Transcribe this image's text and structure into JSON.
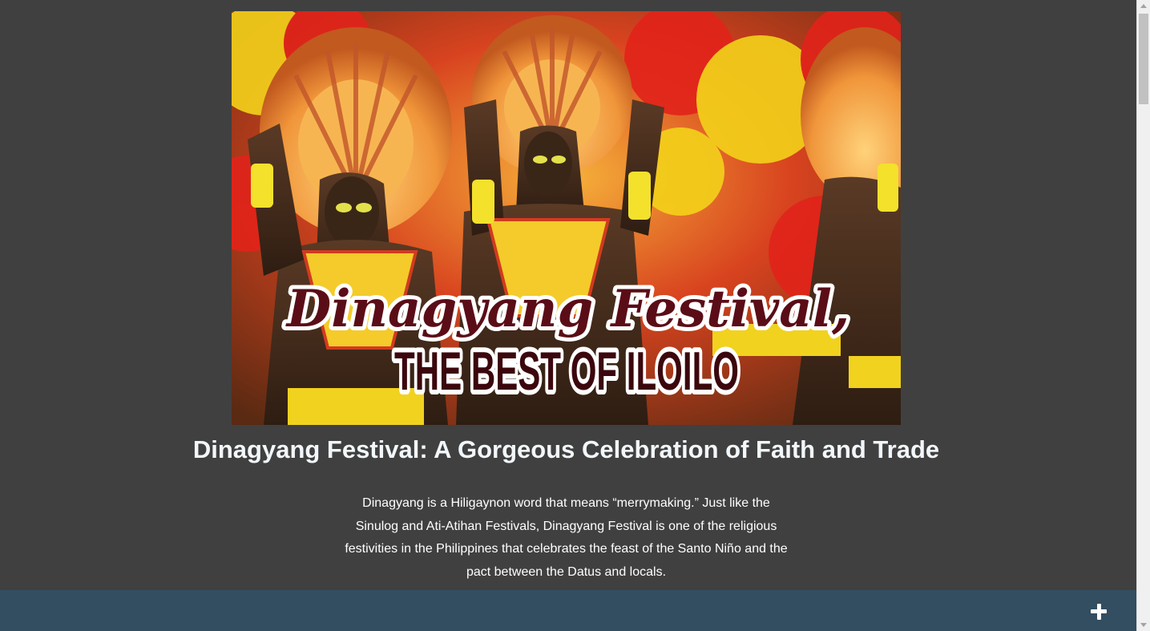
{
  "hero": {
    "title_script": "Dinagyang Festival,",
    "title_block": "THE BEST OF ILOILO"
  },
  "article": {
    "headline": "Dinagyang Festival: A Gorgeous Celebration of Faith and Trade",
    "intro": "Dinagyang is a Hiligaynon word that means “merrymaking.” Just like the Sinulog and Ati-Atihan Festivals, Dinagyang Festival is one of the religious festivities in the Philippines that celebrates the feast of the Santo Niño and the pact between the Datus and locals."
  },
  "footer": {
    "expand_icon": "plus-icon"
  },
  "colors": {
    "page_bg": "#404040",
    "footer_bg": "#334d61",
    "headline": "#f2f7fb"
  }
}
